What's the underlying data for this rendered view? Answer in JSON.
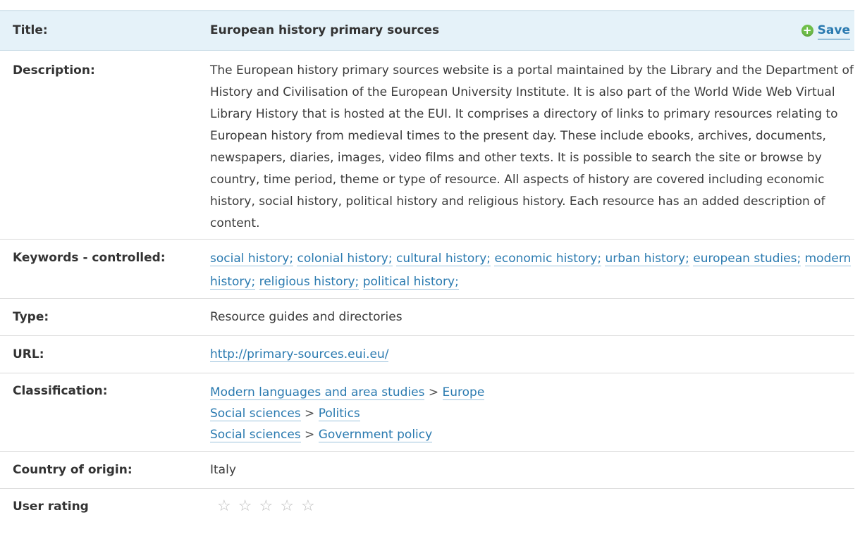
{
  "title_row": {
    "label": "Title:",
    "value": "European history primary sources",
    "save_label": "Save"
  },
  "description": {
    "label": "Description:",
    "text": "The European history primary sources website is a portal maintained by the Library and the Department of History and Civilisation of the European University Institute. It is also part of the World Wide Web Virtual Library History that is hosted at the EUI. It comprises a directory of links to primary resources relating to European history from medieval times to the present day. These include ebooks, archives, documents, newspapers, diaries, images, video films and other texts. It is possible to search the site or browse by country, time period, theme or type of resource. All aspects of history are covered including economic history, social history, political history and religious history. Each resource has an added description of content."
  },
  "keywords": {
    "label": "Keywords - controlled:",
    "items": [
      "social history;",
      "colonial history;",
      "cultural history;",
      "economic history;",
      "urban history;",
      "european studies;",
      "modern history;",
      "religious history;",
      "political history;"
    ]
  },
  "type": {
    "label": "Type:",
    "value": "Resource guides and directories"
  },
  "url": {
    "label": "URL:",
    "value": "http://primary-sources.eui.eu/"
  },
  "classification": {
    "label": "Classification:",
    "separator": ">",
    "paths": [
      [
        "Modern languages and area studies",
        "Europe"
      ],
      [
        "Social sciences",
        "Politics"
      ],
      [
        "Social sciences",
        "Government policy"
      ]
    ]
  },
  "country": {
    "label": "Country of origin:",
    "value": "Italy"
  },
  "rating": {
    "label": "User rating",
    "max_stars": 5,
    "current": 0,
    "star_icon": "star-outline-icon"
  },
  "colors": {
    "link": "#2a7ab0",
    "title_bg": "#e5f2f9",
    "save_icon": "#6fbf4a",
    "star": "#bdbdbd"
  }
}
